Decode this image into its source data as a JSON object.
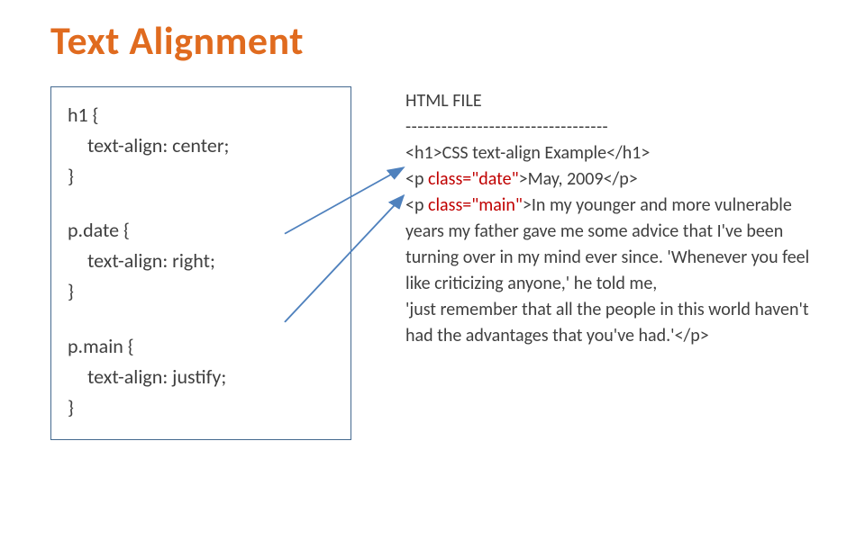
{
  "title": "Text Alignment",
  "css": {
    "rule1_sel": "h1 {",
    "rule1_prop": "text-align: center;",
    "rule1_close": "}",
    "rule2_sel": "p.date {",
    "rule2_prop": "text-align: right;",
    "rule2_close": "}",
    "rule3_sel": "p.main {",
    "rule3_prop": "text-align: justify;",
    "rule3_close": "}"
  },
  "html": {
    "header": "HTML FILE",
    "dashes": "----------------------------------",
    "line1_open": "<h1>",
    "line1_text": "CSS text-align Example",
    "line1_close": "</h1>",
    "line2_open": "<p ",
    "line2_attr": "class=\"date\"",
    "line2_gt": ">",
    "line2_text": "May, 2009",
    "line2_close": "</p>",
    "line3_open": "<p ",
    "line3_attr": "class=\"main\"",
    "line3_gt": ">",
    "line3_text": "In my younger and more vulnerable years my father gave me some advice that I've been turning over in my mind ever since. 'Whenever you feel like criticizing anyone,' he told me,",
    "line3b_text": "'just remember that all the people in this world haven't had the advantages that you've had.'",
    "line3_close": "</p>"
  }
}
